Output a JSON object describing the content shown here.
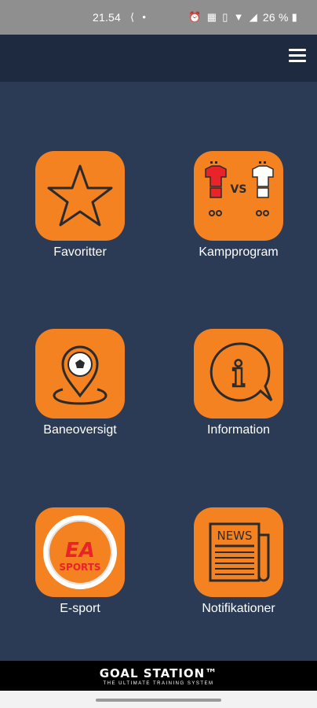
{
  "status_bar": {
    "time": "21.54",
    "battery_percent": "26 %",
    "icons": [
      "share-icon",
      "dot-icon",
      "alarm-icon",
      "calendar-icon",
      "vibrate-icon",
      "wifi-icon",
      "signal-icon",
      "battery-icon"
    ]
  },
  "app_bar": {
    "menu_icon": "hamburger-menu-icon"
  },
  "tiles": [
    {
      "label": "Favoritter",
      "icon": "star-icon"
    },
    {
      "label": "Kampprogram",
      "icon": "match-vs-jerseys-icon",
      "icon_text": "VS"
    },
    {
      "label": "Baneoversigt",
      "icon": "football-location-pin-icon"
    },
    {
      "label": "Information",
      "icon": "info-speech-bubble-icon",
      "icon_text": "i"
    },
    {
      "label": "E-sport",
      "icon": "ea-sports-logo-icon",
      "icon_text": "EA",
      "icon_subtext": "SPORTS"
    },
    {
      "label": "Notifikationer",
      "icon": "newspaper-icon",
      "icon_text": "NEWS"
    }
  ],
  "footer": {
    "brand": "GOAL STATION™",
    "tagline": "THE ULTIMATE TRAINING SYSTEM"
  },
  "colors": {
    "background": "#2b3a55",
    "app_bar": "#1e2a40",
    "tile_accent": "#f58220",
    "icon_stroke": "#2b2b2b",
    "status_bar": "#8f8f8f"
  }
}
